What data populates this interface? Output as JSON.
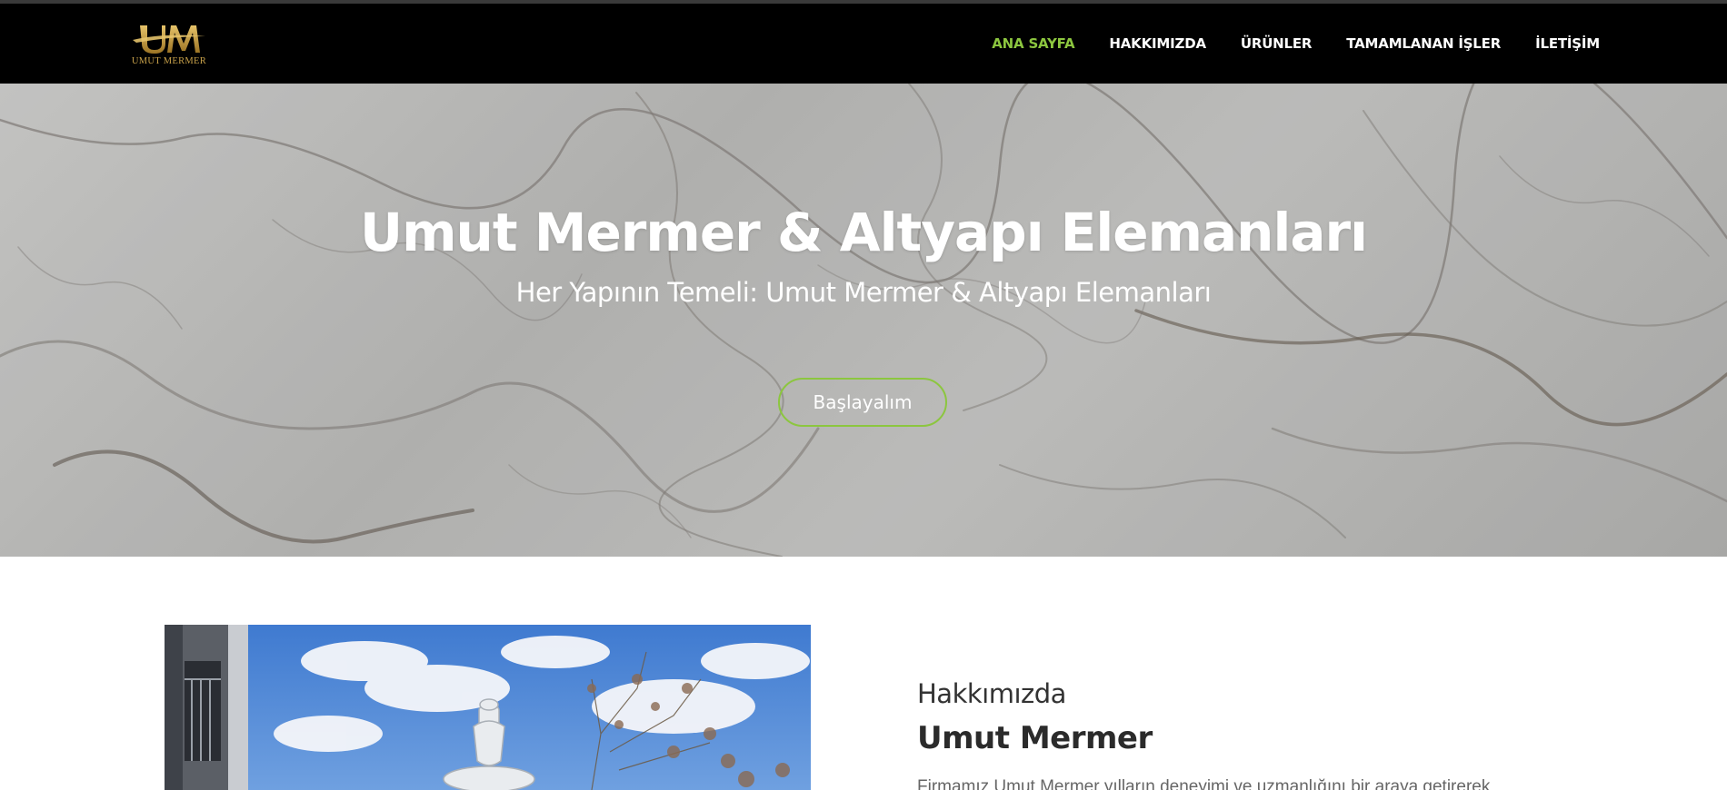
{
  "brand": {
    "logo_monogram": "UM",
    "logo_text": "UMUT MERMER",
    "gold": "#c9a24a"
  },
  "nav": {
    "items": [
      {
        "label": "ANA SAYFA",
        "active": true
      },
      {
        "label": "HAKKIMIZDA",
        "active": false
      },
      {
        "label": "ÜRÜNLER",
        "active": false
      },
      {
        "label": "TAMAMLANAN İŞLER",
        "active": false
      },
      {
        "label": "İLETİŞİM",
        "active": false
      }
    ],
    "active_color": "#8cc63f",
    "background": "#000000"
  },
  "hero": {
    "title": "Umut Mermer & Altyapı Elemanları",
    "subtitle": "Her Yapının Temeli: Umut Mermer & Altyapı Elemanları",
    "cta_label": "Başlayalım",
    "accent": "#8cc63f"
  },
  "about": {
    "kicker": "Hakkımızda",
    "title": "Umut Mermer",
    "text": "Firmamız Umut Mermer yılların deneyimi ve uzmanlığını bir araya getirerek"
  }
}
